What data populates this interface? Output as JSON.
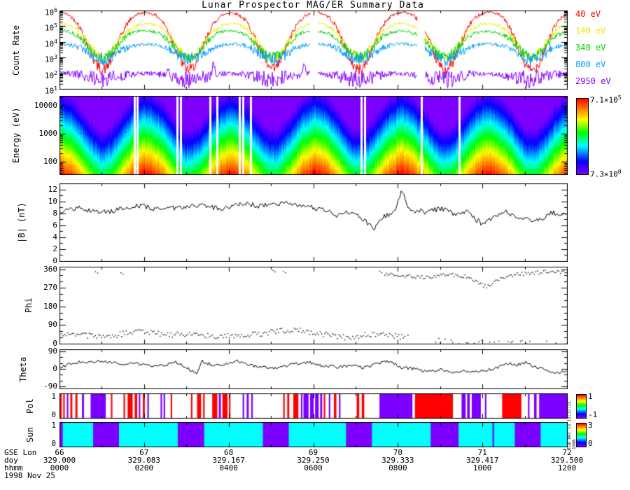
{
  "title": "Lunar Prospector MAG/ER Summary Data",
  "timestamp": "Tue Dec 15 15:37:15 1998",
  "bottom_axis": {
    "row_labels": [
      "GSE Lon",
      "doy",
      "hhmm",
      "1998 Nov 25"
    ],
    "gse_lon": [
      "66",
      "67",
      "68",
      "69",
      "70",
      "71",
      "72"
    ],
    "doy": [
      "329.000",
      "329.083",
      "329.167",
      "329.250",
      "329.333",
      "329.417",
      "329.500"
    ],
    "hhmm": [
      "0000",
      "0200",
      "0400",
      "0600",
      "0800",
      "1000",
      "1200"
    ]
  },
  "chart_data": [
    {
      "id": "count_rate",
      "type": "line",
      "ylabel": "Count Rate",
      "yscale": "log",
      "ylim": [
        10,
        1000000
      ],
      "yticks": [
        "10^1",
        "10^2",
        "10^3",
        "10^4",
        "10^5",
        "10^6"
      ],
      "x_span_hours": [
        0,
        12
      ],
      "dip_centers": [
        0.085,
        0.255,
        0.42,
        0.59,
        0.76,
        0.93
      ],
      "dip_halfwidth": 0.048,
      "line_gaps": [
        [
          0.495,
          0.508
        ],
        [
          0.705,
          0.72
        ]
      ],
      "series": [
        {
          "name": "40 eV",
          "color": "#ff0000",
          "plateau_log": 5.95,
          "dip_min_log": 2.2,
          "noise_log": 0.06
        },
        {
          "name": "140 eV",
          "color": "#eded00",
          "plateau_log": 5.16,
          "dip_min_log": 3.0,
          "noise_log": 0.06
        },
        {
          "name": "340 eV",
          "color": "#00d400",
          "plateau_log": 4.72,
          "dip_min_log": 3.0,
          "noise_log": 0.06
        },
        {
          "name": "800 eV",
          "color": "#009cff",
          "plateau_log": 3.85,
          "dip_min_log": 2.9,
          "noise_log": 0.07
        },
        {
          "name": "2950 eV",
          "color": "#8400ff",
          "plateau_log": 1.95,
          "dip_min_log": 1.62,
          "noise_log": 0.1,
          "spikes": [
            0.215,
            0.303,
            0.482
          ]
        }
      ]
    },
    {
      "id": "spectrogram",
      "type": "heatmap",
      "ylabel": "Energy (eV)",
      "yscale": "log",
      "ylim": [
        35,
        22000
      ],
      "yticks": [
        "100",
        "1000",
        "10000"
      ],
      "colormap": "rainbow",
      "value_range_label": {
        "max": "7.1×10^5",
        "min": "7.3×10^0"
      },
      "gap_fracs": [
        0.147,
        0.153,
        0.232,
        0.238,
        0.297,
        0.31,
        0.355,
        0.362,
        0.376,
        0.594,
        0.602,
        0.713,
        0.787
      ],
      "dip_centers": [
        0.085,
        0.255,
        0.42,
        0.59,
        0.76,
        0.93
      ],
      "dip_halfwidth": 0.05
    },
    {
      "id": "b_field",
      "type": "line",
      "ylabel": "|B| (nT)",
      "ylim": [
        0,
        13
      ],
      "yticks": [
        0,
        2,
        4,
        6,
        8,
        10,
        12
      ],
      "noise": 0.45,
      "points": [
        [
          0,
          8.2
        ],
        [
          0.04,
          9.0
        ],
        [
          0.08,
          8.0
        ],
        [
          0.12,
          8.8
        ],
        [
          0.16,
          9.2
        ],
        [
          0.2,
          8.6
        ],
        [
          0.24,
          9.0
        ],
        [
          0.28,
          9.4
        ],
        [
          0.32,
          8.8
        ],
        [
          0.36,
          9.6
        ],
        [
          0.4,
          9.2
        ],
        [
          0.44,
          9.8
        ],
        [
          0.48,
          9.3
        ],
        [
          0.52,
          8.6
        ],
        [
          0.55,
          7.6
        ],
        [
          0.58,
          8.4
        ],
        [
          0.6,
          6.8
        ],
        [
          0.62,
          5.3
        ],
        [
          0.64,
          7.5
        ],
        [
          0.66,
          8.3
        ],
        [
          0.675,
          11.8
        ],
        [
          0.69,
          8.6
        ],
        [
          0.72,
          8.2
        ],
        [
          0.75,
          8.8
        ],
        [
          0.78,
          7.8
        ],
        [
          0.8,
          8.4
        ],
        [
          0.83,
          6.3
        ],
        [
          0.86,
          7.6
        ],
        [
          0.88,
          8.2
        ],
        [
          0.9,
          7.4
        ],
        [
          0.93,
          6.9
        ],
        [
          0.95,
          7.2
        ],
        [
          0.97,
          8.0
        ],
        [
          1,
          7.8
        ]
      ]
    },
    {
      "id": "phi",
      "type": "scatter",
      "ylabel": "Phi",
      "ylim": [
        0,
        372
      ],
      "yticks": [
        0,
        90,
        180,
        270,
        360
      ],
      "bands": [
        {
          "name": "low",
          "noise": 13,
          "sparse_after": 0.68,
          "points": [
            [
              0,
              55
            ],
            [
              0.05,
              40
            ],
            [
              0.1,
              35
            ],
            [
              0.14,
              60
            ],
            [
              0.18,
              55
            ],
            [
              0.22,
              45
            ],
            [
              0.26,
              50
            ],
            [
              0.3,
              35
            ],
            [
              0.34,
              40
            ],
            [
              0.38,
              45
            ],
            [
              0.42,
              60
            ],
            [
              0.46,
              70
            ],
            [
              0.5,
              55
            ],
            [
              0.54,
              40
            ],
            [
              0.57,
              30
            ],
            [
              0.6,
              45
            ],
            [
              0.63,
              50
            ],
            [
              0.66,
              40
            ],
            [
              0.7,
              25
            ],
            [
              0.74,
              20
            ],
            [
              0.78,
              15
            ],
            [
              0.82,
              10
            ],
            [
              0.88,
              8
            ],
            [
              0.93,
              12
            ],
            [
              1,
              8
            ]
          ]
        },
        {
          "name": "high",
          "noise": 9,
          "start": 0.64,
          "points": [
            [
              0.64,
              340
            ],
            [
              0.68,
              332
            ],
            [
              0.72,
              322
            ],
            [
              0.76,
              336
            ],
            [
              0.8,
              326
            ],
            [
              0.84,
              276
            ],
            [
              0.86,
              312
            ],
            [
              0.9,
              336
            ],
            [
              0.94,
              346
            ],
            [
              0.97,
              352
            ],
            [
              1,
              346
            ]
          ]
        }
      ],
      "stray_points": [
        [
          0.07,
          350
        ],
        [
          0.42,
          356
        ],
        [
          0.44,
          352
        ],
        [
          0.63,
          352
        ],
        [
          0.12,
          345
        ]
      ]
    },
    {
      "id": "theta",
      "type": "line",
      "ylabel": "Theta",
      "ylim": [
        -100,
        100
      ],
      "yticks": [
        -90,
        0,
        90
      ],
      "noise": 8,
      "points": [
        [
          0,
          10
        ],
        [
          0.03,
          30
        ],
        [
          0.06,
          40
        ],
        [
          0.09,
          35
        ],
        [
          0.12,
          25
        ],
        [
          0.15,
          30
        ],
        [
          0.17,
          20
        ],
        [
          0.2,
          15
        ],
        [
          0.23,
          35
        ],
        [
          0.25,
          10
        ],
        [
          0.27,
          -30
        ],
        [
          0.28,
          40
        ],
        [
          0.3,
          20
        ],
        [
          0.33,
          25
        ],
        [
          0.35,
          40
        ],
        [
          0.37,
          20
        ],
        [
          0.4,
          10
        ],
        [
          0.43,
          5
        ],
        [
          0.46,
          25
        ],
        [
          0.49,
          35
        ],
        [
          0.52,
          15
        ],
        [
          0.55,
          10
        ],
        [
          0.58,
          20
        ],
        [
          0.6,
          5
        ],
        [
          0.63,
          30
        ],
        [
          0.65,
          40
        ],
        [
          0.67,
          10
        ],
        [
          0.7,
          0
        ],
        [
          0.72,
          -10
        ],
        [
          0.75,
          -5
        ],
        [
          0.78,
          -20
        ],
        [
          0.8,
          -10
        ],
        [
          0.83,
          -15
        ],
        [
          0.86,
          5
        ],
        [
          0.88,
          30
        ],
        [
          0.9,
          20
        ],
        [
          0.92,
          35
        ],
        [
          0.94,
          5
        ],
        [
          0.96,
          -5
        ],
        [
          0.98,
          -20
        ],
        [
          1,
          -10
        ]
      ]
    },
    {
      "id": "pol",
      "type": "bars",
      "ylabel": "Pol",
      "yticks": [
        "0",
        "1"
      ],
      "colorbar": {
        "top": "1",
        "bottom": "-1"
      },
      "colors": {
        "R": "#ff0000",
        "P": "#7b00ff",
        "background": "#ffffff"
      },
      "segments": [
        [
          0,
          0.003,
          "R"
        ],
        [
          0.006,
          0.009,
          "R"
        ],
        [
          0.013,
          0.016,
          "P"
        ],
        [
          0.02,
          0.024,
          "R"
        ],
        [
          0.03,
          0.034,
          "R"
        ],
        [
          0.043,
          0.047,
          "P"
        ],
        [
          0.06,
          0.09,
          "P"
        ],
        [
          0.1,
          0.103,
          "R"
        ],
        [
          0.125,
          0.128,
          "R"
        ],
        [
          0.133,
          0.143,
          "R"
        ],
        [
          0.147,
          0.152,
          "R"
        ],
        [
          0.155,
          0.158,
          "P"
        ],
        [
          0.163,
          0.167,
          "R"
        ],
        [
          0.172,
          0.175,
          "P"
        ],
        [
          0.198,
          0.201,
          "P"
        ],
        [
          0.204,
          0.207,
          "P"
        ],
        [
          0.218,
          0.221,
          "R"
        ],
        [
          0.258,
          0.261,
          "R"
        ],
        [
          0.27,
          0.278,
          "R"
        ],
        [
          0.282,
          0.285,
          "R"
        ],
        [
          0.3,
          0.31,
          "R"
        ],
        [
          0.313,
          0.317,
          "P"
        ],
        [
          0.32,
          0.33,
          "R"
        ],
        [
          0.333,
          0.336,
          "R"
        ],
        [
          0.36,
          0.363,
          "P"
        ],
        [
          0.368,
          0.372,
          "P"
        ],
        [
          0.377,
          0.38,
          "P"
        ],
        [
          0.44,
          0.443,
          "R"
        ],
        [
          0.448,
          0.452,
          "R"
        ],
        [
          0.46,
          0.47,
          "R"
        ],
        [
          0.475,
          0.478,
          "P"
        ],
        [
          0.48,
          0.49,
          "P"
        ],
        [
          0.493,
          0.5,
          "P"
        ],
        [
          0.503,
          0.51,
          "P"
        ],
        [
          0.513,
          0.517,
          "P"
        ],
        [
          0.52,
          0.523,
          "R"
        ],
        [
          0.53,
          0.533,
          "P"
        ],
        [
          0.54,
          0.545,
          "R"
        ],
        [
          0.55,
          0.553,
          "P"
        ],
        [
          0.585,
          0.59,
          "R"
        ],
        [
          0.595,
          0.6,
          "R"
        ],
        [
          0.63,
          0.695,
          "P"
        ],
        [
          0.7,
          0.775,
          "R"
        ],
        [
          0.792,
          0.8,
          "P"
        ],
        [
          0.803,
          0.808,
          "P"
        ],
        [
          0.812,
          0.83,
          "P"
        ],
        [
          0.838,
          0.841,
          "P"
        ],
        [
          0.872,
          0.91,
          "R"
        ],
        [
          0.923,
          0.926,
          "P"
        ],
        [
          0.935,
          0.94,
          "P"
        ],
        [
          0.945,
          1,
          "P"
        ]
      ]
    },
    {
      "id": "sun",
      "type": "bars",
      "ylabel": "Sun",
      "yticks": [
        "0",
        "1"
      ],
      "colorbar": {
        "top": "3",
        "bottom": "0"
      },
      "colors": {
        "S": "#7b00ff",
        "background": "#00ffff"
      },
      "segments": [
        [
          0,
          0.005,
          "S"
        ],
        [
          0.065,
          0.116,
          "S"
        ],
        [
          0.232,
          0.284,
          "S"
        ],
        [
          0.4,
          0.451,
          "S"
        ],
        [
          0.564,
          0.615,
          "S"
        ],
        [
          0.731,
          0.786,
          "S"
        ],
        [
          0.853,
          0.856,
          "S"
        ],
        [
          0.897,
          0.948,
          "S"
        ]
      ]
    }
  ]
}
